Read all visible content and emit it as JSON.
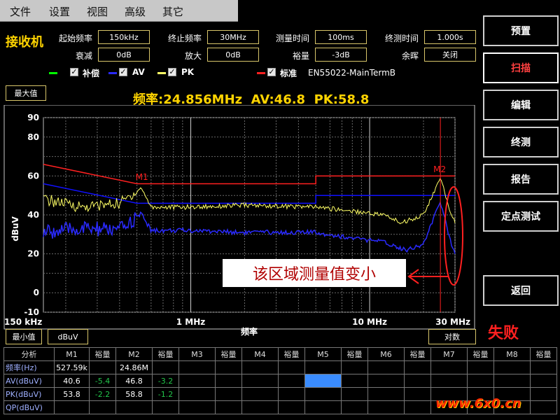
{
  "menu": [
    "文件",
    "设置",
    "视图",
    "高级",
    "其它"
  ],
  "brand": "接收机",
  "params": [
    {
      "label": "起始频率",
      "value": "150kHz"
    },
    {
      "label": "终止频率",
      "value": "30MHz"
    },
    {
      "label": "测量时间",
      "value": "100ms"
    },
    {
      "label": "终测时间",
      "value": "1.000s"
    },
    {
      "label": "衰减",
      "value": "0dB"
    },
    {
      "label": "放大",
      "value": "0dB"
    },
    {
      "label": "裕量",
      "value": "-3dB"
    },
    {
      "label": "余晖",
      "value": "关闭"
    }
  ],
  "legend": [
    {
      "checked": "✓",
      "label": "补偿",
      "color": "#00ff00"
    },
    {
      "checked": "✓",
      "label": "AV",
      "color": "#2a2aff"
    },
    {
      "checked": "✓",
      "label": "PK",
      "color": "#ffff66"
    },
    {
      "checked": "✓",
      "label": "标准",
      "color": "#ff2020"
    }
  ],
  "standard": "EN55022-MainTermB",
  "buttons": [
    "预置",
    "扫描",
    "编辑",
    "终测",
    "报告",
    "定点测试",
    "返回"
  ],
  "max_label": "最大值",
  "min_label": "最小值",
  "unit_box": "dBuV",
  "scale_box": "对数",
  "readout": "频率:24.856MHz  AV:46.8  PK:58.8",
  "status": "失败",
  "annotation": "该区域测量值变小",
  "watermark": "www.6x0.cn",
  "chart_data": {
    "type": "line",
    "xlabel": "频率",
    "ylabel": "dBuV",
    "x_scale": "log",
    "xlim": [
      0.15,
      30
    ],
    "ylim": [
      -10,
      90
    ],
    "x_ticks": [
      "150 kHz",
      "1 MHz",
      "10 MHz",
      "30 MHz"
    ],
    "y_ticks": [
      "90",
      "80",
      "60",
      "40",
      "20",
      "0",
      "-10"
    ],
    "grid": true,
    "markers": [
      {
        "name": "M1",
        "freq_mhz": 0.528
      },
      {
        "name": "M2",
        "freq_mhz": 24.856
      }
    ],
    "series": [
      {
        "name": "标准",
        "color": "#ff2020",
        "points": [
          [
            0.15,
            66
          ],
          [
            0.5,
            56
          ],
          [
            5,
            56
          ],
          [
            5,
            60
          ],
          [
            30,
            60
          ]
        ]
      },
      {
        "name": "标准 AV",
        "color": "#1010ff",
        "points": [
          [
            0.15,
            56
          ],
          [
            0.5,
            46
          ],
          [
            5,
            46
          ],
          [
            5,
            50
          ],
          [
            30,
            50
          ]
        ]
      },
      {
        "name": "PK",
        "color": "#ffff66",
        "points": [
          [
            0.15,
            48
          ],
          [
            0.25,
            44
          ],
          [
            0.4,
            46
          ],
          [
            0.53,
            53.8
          ],
          [
            0.6,
            44
          ],
          [
            1,
            44
          ],
          [
            2,
            45
          ],
          [
            5,
            44
          ],
          [
            8,
            42
          ],
          [
            12,
            40
          ],
          [
            15,
            36
          ],
          [
            20,
            40
          ],
          [
            24.86,
            58.8
          ],
          [
            28,
            43
          ],
          [
            30,
            36
          ]
        ]
      },
      {
        "name": "AV",
        "color": "#2a2aff",
        "points": [
          [
            0.15,
            31
          ],
          [
            0.25,
            33
          ],
          [
            0.4,
            32
          ],
          [
            0.53,
            40.6
          ],
          [
            0.6,
            32
          ],
          [
            1,
            32
          ],
          [
            2,
            31
          ],
          [
            5,
            31
          ],
          [
            8,
            28
          ],
          [
            12,
            26
          ],
          [
            16,
            22
          ],
          [
            20,
            25
          ],
          [
            24.86,
            46.8
          ],
          [
            28,
            28
          ],
          [
            30,
            20
          ]
        ]
      }
    ]
  },
  "table": {
    "headers": [
      "分析",
      "M1",
      "裕量",
      "M2",
      "裕量",
      "M3",
      "裕量",
      "M4",
      "裕量",
      "M5",
      "裕量",
      "M6",
      "裕量",
      "M7",
      "裕量",
      "M8",
      "裕量"
    ],
    "rows": [
      {
        "name": "频率(Hz)",
        "m1": "527.59k",
        "m1m": "",
        "m2": "24.86M",
        "m2m": ""
      },
      {
        "name": "AV(dBuV)",
        "m1": "40.6",
        "m1m": "-5.4",
        "m2": "46.8",
        "m2m": "-3.2"
      },
      {
        "name": "PK(dBuV)",
        "m1": "53.8",
        "m1m": "-2.2",
        "m2": "58.8",
        "m2m": "-1.2"
      },
      {
        "name": "QP(dBuV)",
        "m1": "",
        "m1m": "",
        "m2": "",
        "m2m": ""
      }
    ]
  }
}
